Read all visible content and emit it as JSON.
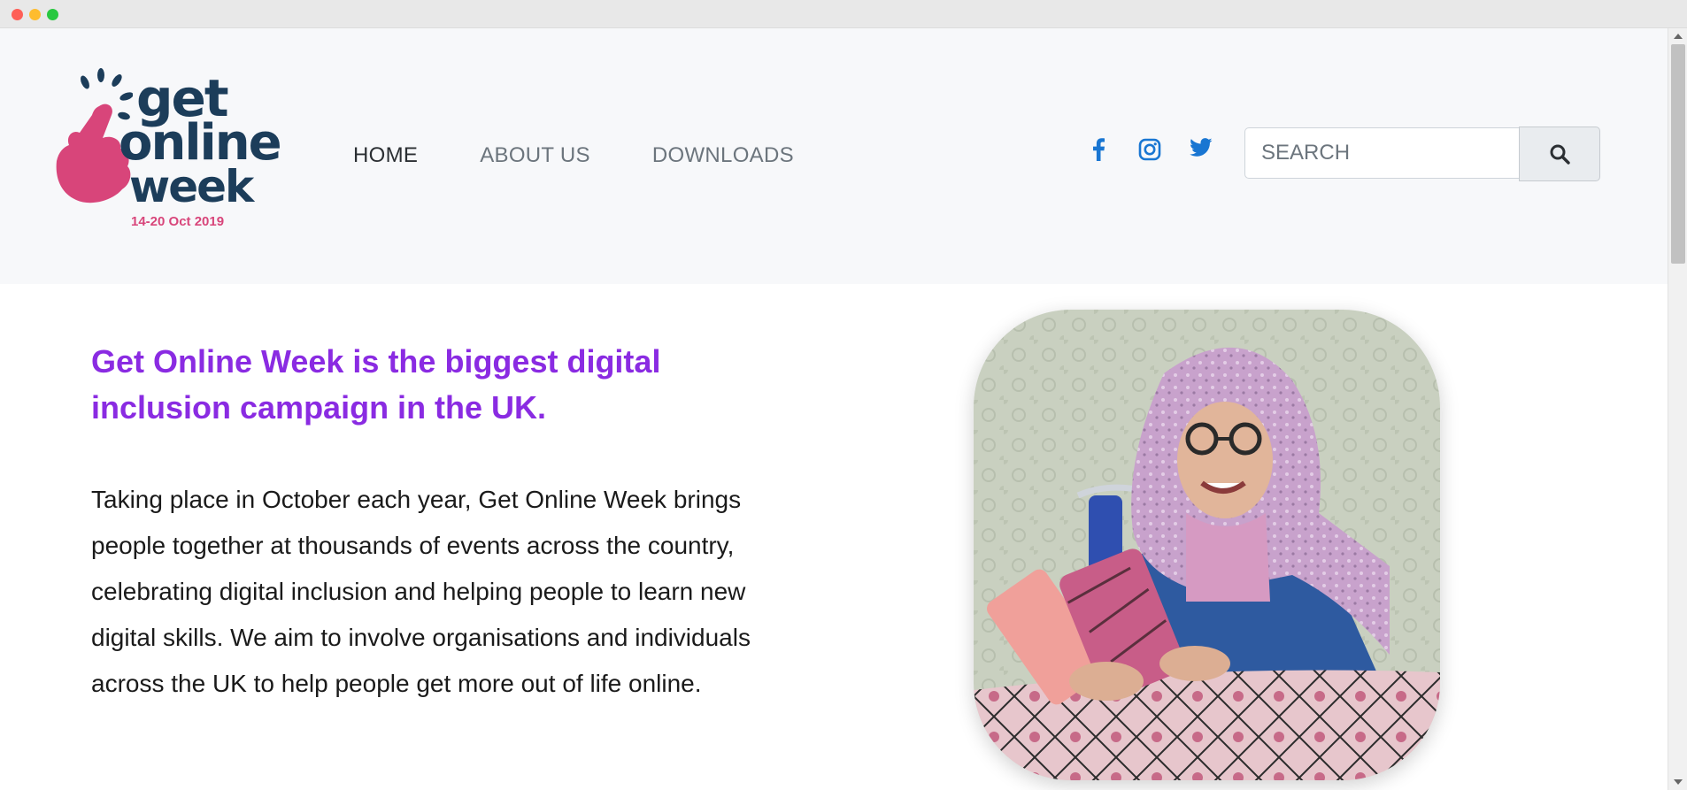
{
  "window": {
    "controls": [
      "close",
      "minimize",
      "maximize"
    ]
  },
  "header": {
    "logo": {
      "line1": "get",
      "line2": "online",
      "line3": "week",
      "date": "14-20 Oct 2019",
      "colors": {
        "navy": "#1c3d5a",
        "pink": "#d8457a"
      }
    },
    "nav": [
      {
        "label": "HOME",
        "active": true
      },
      {
        "label": "ABOUT US",
        "active": false
      },
      {
        "label": "DOWNLOADS",
        "active": false
      }
    ],
    "social": [
      "facebook-icon",
      "instagram-icon",
      "twitter-icon"
    ],
    "search": {
      "placeholder": "SEARCH",
      "button_icon": "search-icon"
    }
  },
  "main": {
    "headline": "Get Online Week is the biggest digital inclusion campaign in the UK.",
    "body": "Taking place in October each year, Get Online Week brings people together at thousands of events across the country, celebrating digital inclusion and helping people to learn new digital skills. We aim to involve organisations and individuals across the UK to help people get more out of life online.",
    "image_subject": "smiling older woman in a pink headscarf using a smartphone",
    "colors": {
      "headline": "#8a2be2",
      "social": "#1976d2"
    }
  }
}
